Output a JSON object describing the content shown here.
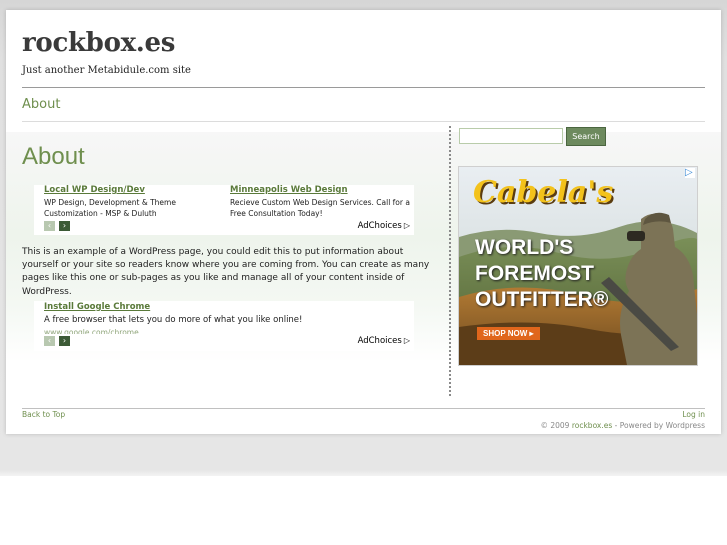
{
  "site": {
    "title": "rockbox.es",
    "tagline": "Just another Metabidule.com site"
  },
  "nav": {
    "about": "About"
  },
  "main": {
    "heading": "About",
    "paragraph": "This is an example of a WordPress page, you could edit this to put information about yourself or your site so readers know where you are coming from. You can create as many pages like this one or sub-pages as you like and manage all of your content inside of WordPress."
  },
  "ad_top": {
    "items": [
      {
        "title": "Local WP Design/Dev",
        "desc": "WP Design, Development & Theme Customization - MSP & Duluth"
      },
      {
        "title": "Minneapolis Web Design",
        "desc": "Recieve Custom Web Design Services. Call for a Free Consultation Today!"
      }
    ],
    "adchoices": "AdChoices"
  },
  "ad_bottom": {
    "title": "Install Google Chrome",
    "desc": "A free browser that lets you do more of what you like online!",
    "url": "www.google.com/chrome",
    "adchoices": "AdChoices"
  },
  "sidebar": {
    "search_value": "",
    "search_button": "Search",
    "banner": {
      "brand": "Cabela's",
      "headline_1": "WORLD'S",
      "headline_2": "FOREMOST",
      "headline_3": "OUTFITTER®",
      "cta": "SHOP NOW"
    }
  },
  "footer": {
    "back_to_top": "Back to Top",
    "login": "Log in",
    "copyright_prefix": "© 2009",
    "copyright_site": "rockbox.es",
    "copyright_suffix": "- Powered by Wordpress"
  },
  "colors": {
    "accent_green": "#6f8f4e",
    "search_button": "#6d8a5e",
    "cta_orange": "#e0661c"
  }
}
